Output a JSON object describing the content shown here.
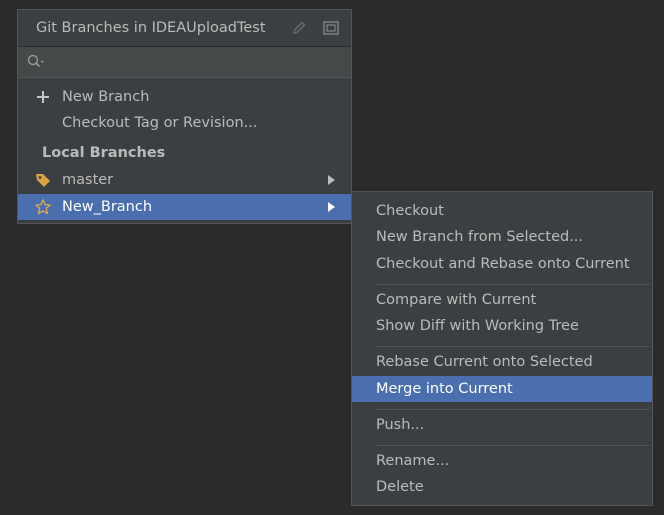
{
  "popup": {
    "title": "Git Branches in IDEAUploadTest",
    "search": {
      "placeholder": "",
      "value": ""
    },
    "actions": [
      {
        "label": "New Branch",
        "icon": "plus-icon"
      },
      {
        "label": "Checkout Tag or Revision...",
        "icon": ""
      }
    ],
    "local_branches": {
      "header": "Local Branches",
      "items": [
        {
          "label": "master",
          "icon": "tag-icon",
          "selected": false
        },
        {
          "label": "New_Branch",
          "icon": "star-icon",
          "selected": true
        }
      ]
    }
  },
  "submenu": {
    "groups": [
      [
        "Checkout",
        "New Branch from Selected...",
        "Checkout and Rebase onto Current"
      ],
      [
        "Compare with Current",
        "Show Diff with Working Tree"
      ],
      [
        "Rebase Current onto Selected",
        "Merge into Current"
      ],
      [
        "Push..."
      ],
      [
        "Rename...",
        "Delete"
      ]
    ],
    "highlighted": "Merge into Current"
  },
  "colors": {
    "background": "#2b2b2b",
    "popup_bg": "#3c3f41",
    "selection": "#4b6eaf",
    "text": "#bbbbbb",
    "tag_icon": "#d9a343"
  }
}
